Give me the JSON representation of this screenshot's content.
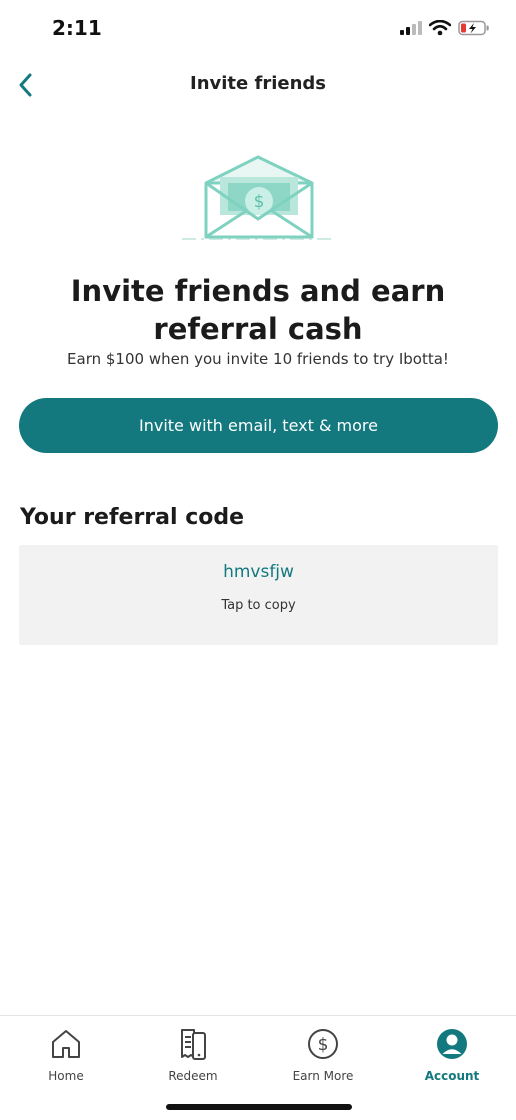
{
  "status_bar": {
    "time": "2:11"
  },
  "header": {
    "title": "Invite friends"
  },
  "hero": {
    "headline": "Invite friends and earn referral cash",
    "subhead": "Earn $100 when you invite 10 friends to try Ibotta!"
  },
  "invite_button": {
    "label": "Invite with email, text & more"
  },
  "referral": {
    "section_title": "Your referral code",
    "code": "hmvsfjw",
    "hint": "Tap to copy"
  },
  "tabs": [
    {
      "label": "Home",
      "icon": "home-icon",
      "active": false
    },
    {
      "label": "Redeem",
      "icon": "receipt-phone-icon",
      "active": false
    },
    {
      "label": "Earn More",
      "icon": "dollar-circle-icon",
      "active": false
    },
    {
      "label": "Account",
      "icon": "account-icon",
      "active": true
    }
  ],
  "colors": {
    "accent": "#13797f",
    "illustration": "#7fd1c0",
    "code_box_bg": "#f2f2f2"
  }
}
